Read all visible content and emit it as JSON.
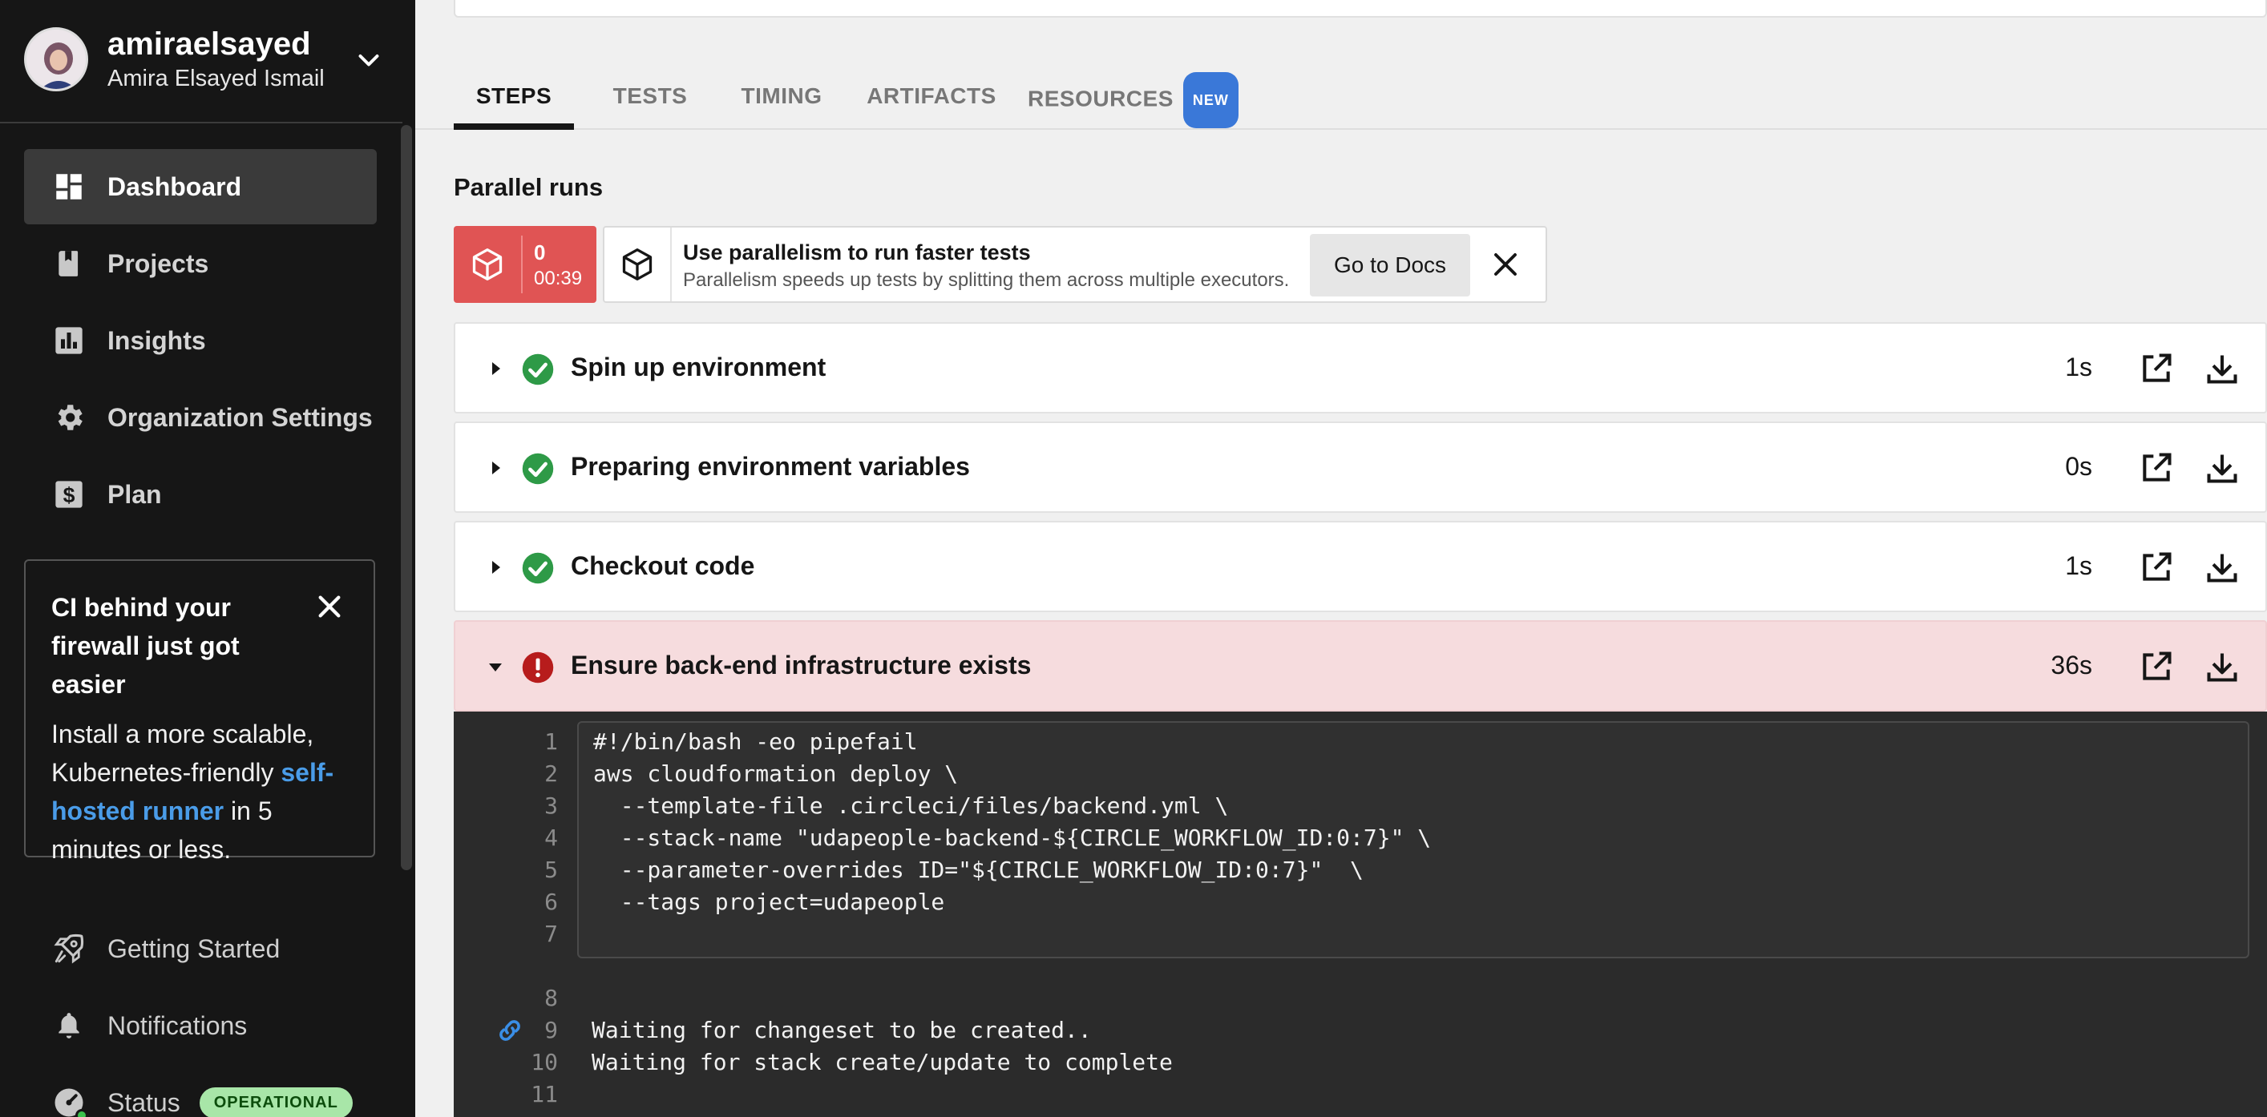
{
  "profile": {
    "username": "amiraelsayed",
    "full_name": "Amira Elsayed Ismail"
  },
  "nav": {
    "items": [
      {
        "label": "Dashboard",
        "icon": "dashboard-icon",
        "active": true
      },
      {
        "label": "Projects",
        "icon": "book-icon"
      },
      {
        "label": "Insights",
        "icon": "bar-chart-icon"
      },
      {
        "label": "Organization Settings",
        "icon": "gear-icon"
      },
      {
        "label": "Plan",
        "icon": "dollar-icon"
      }
    ]
  },
  "promo": {
    "title": "CI behind your firewall just got easier",
    "body_before": "Install a more scalable, Kubernetes-friendly ",
    "link": "self-hosted runner",
    "body_after": " in 5 minutes or less."
  },
  "bottom_nav": {
    "getting_started": "Getting Started",
    "notifications": "Notifications",
    "status": "Status",
    "status_badge": "OPERATIONAL"
  },
  "tabs": {
    "steps": "STEPS",
    "tests": "TESTS",
    "timing": "TIMING",
    "artifacts": "ARTIFACTS",
    "resources": "RESOURCES",
    "new_badge": "NEW"
  },
  "parallel": {
    "title": "Parallel runs",
    "run_index": "0",
    "run_time": "00:39",
    "tip_title": "Use parallelism to run faster tests",
    "tip_subtitle": "Parallelism speeds up tests by splitting them across multiple executors.",
    "docs_button": "Go to Docs"
  },
  "steps": [
    {
      "name": "Spin up environment",
      "duration": "1s",
      "status": "success"
    },
    {
      "name": "Preparing environment variables",
      "duration": "0s",
      "status": "success"
    },
    {
      "name": "Checkout code",
      "duration": "1s",
      "status": "success"
    },
    {
      "name": "Ensure back-end infrastructure exists",
      "duration": "36s",
      "status": "failed"
    }
  ],
  "code": {
    "lines": [
      {
        "n": "1",
        "text": "#!/bin/bash -eo pipefail"
      },
      {
        "n": "2",
        "text": "aws cloudformation deploy \\"
      },
      {
        "n": "3",
        "text": "  --template-file .circleci/files/backend.yml \\"
      },
      {
        "n": "4",
        "text": "  --stack-name \"udapeople-backend-${CIRCLE_WORKFLOW_ID:0:7}\" \\"
      },
      {
        "n": "5",
        "text": "  --parameter-overrides ID=\"${CIRCLE_WORKFLOW_ID:0:7}\"  \\"
      },
      {
        "n": "6",
        "text": "  --tags project=udapeople"
      },
      {
        "n": "7",
        "text": ""
      }
    ],
    "output_lines": [
      {
        "n": "8",
        "text": ""
      },
      {
        "n": "9",
        "text": "Waiting for changeset to be created.."
      },
      {
        "n": "10",
        "text": "Waiting for stack create/update to complete"
      },
      {
        "n": "11",
        "text": ""
      }
    ]
  },
  "colors": {
    "sidebar_bg": "#161616",
    "accent_blue": "#3a78d8",
    "success_green": "#2e9a47",
    "failed_red": "#b71c1c",
    "failed_row_bg": "#f6dcde",
    "parallel_red": "#e05454"
  }
}
